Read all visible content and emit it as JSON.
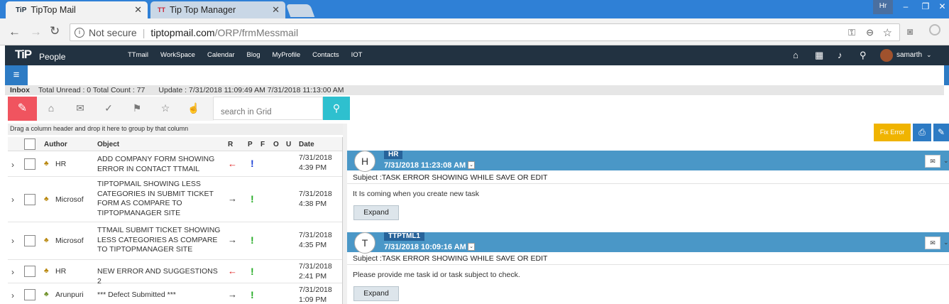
{
  "browser": {
    "tabs": [
      {
        "title": "TipTop Mail",
        "icon": "TiP"
      },
      {
        "title": "Tip Top Manager",
        "icon": "TT"
      }
    ],
    "profile": "Hr",
    "security": "Not secure",
    "url_host": "tiptopmail.com",
    "url_path": "/ORP/frmMessmail"
  },
  "app": {
    "logo": "TiP",
    "logo_suffix": "People",
    "nav": [
      "TTmail",
      "WorkSpace",
      "Calendar",
      "Blog",
      "MyProfile",
      "Contacts",
      "IOT"
    ],
    "user": "samarth"
  },
  "inbox": {
    "label": "Inbox",
    "counts": "Total Unread : 0 Total Count : 77",
    "update": "Update :  7/31/2018 11:09:49 AM 7/31/2018 11:13:00 AM",
    "search_placeholder": "search in Grid",
    "group_hint": "Drag a column header and drop it here to group by that column"
  },
  "grid": {
    "headers": {
      "author": "Author",
      "object": "Object",
      "r": "R",
      "p": "P",
      "f": "F",
      "o": "O",
      "u": "U",
      "date": "Date"
    },
    "rows": [
      {
        "author": "HR",
        "object": "ADD COMPANY FORM SHOWING ERROR IN CONTACT TTMAIL",
        "arrow": "←",
        "priority": "!",
        "date": "7/31/2018",
        "time": "4:39 PM"
      },
      {
        "author": "Microsof",
        "object": "TIPTOPMAIL SHOWING LESS CATEGORIES IN SUBMIT TICKET FORM AS COMPARE TO TIPTOPMANAGER SITE",
        "arrow": "→",
        "priority": "!",
        "date": "7/31/2018",
        "time": "4:38 PM"
      },
      {
        "author": "Microsof",
        "object": "TTMAIL SUBMIT TICKET SHOWING LESS CATEGORIES AS COMPARE TO TIPTOPMANAGER SITE",
        "arrow": "→",
        "priority": "!",
        "date": "7/31/2018",
        "time": "4:35 PM"
      },
      {
        "author": "HR",
        "object": "NEW ERROR AND SUGGESTIONS 2",
        "arrow": "←",
        "priority": "!",
        "date": "7/31/2018",
        "time": "2:41 PM"
      },
      {
        "author": "Arunpuri",
        "object": "*** Defect Submitted ***",
        "arrow": "→",
        "priority": "!",
        "date": "7/31/2018",
        "time": "1:09 PM"
      }
    ]
  },
  "reader": {
    "fix_error": "Fix Error",
    "messages": [
      {
        "initial": "H",
        "sender": "HR",
        "datetime": "7/31/2018 11:23:08 AM",
        "subject": "Subject :TASK ERROR SHOWING WHILE SAVE OR EDIT",
        "body": "It Is coming when you create new task",
        "expand": "Expand"
      },
      {
        "initial": "T",
        "sender": "TTPTML1",
        "datetime": "7/31/2018 10:09:16 AM",
        "subject": "Subject :TASK ERROR SHOWING WHILE SAVE OR EDIT",
        "body": "Please provide me task id or task subject to check.",
        "expand": "Expand"
      }
    ]
  },
  "colors": {
    "navbar": "#223241",
    "accent_red": "#f0545f",
    "search_teal": "#2ec0cf",
    "msg_header": "#4a97c7",
    "fix_error": "#f0b400",
    "priority_green": "#22aa22",
    "priority_blue": "#1a3fd6",
    "arrow_red": "#e02020"
  }
}
